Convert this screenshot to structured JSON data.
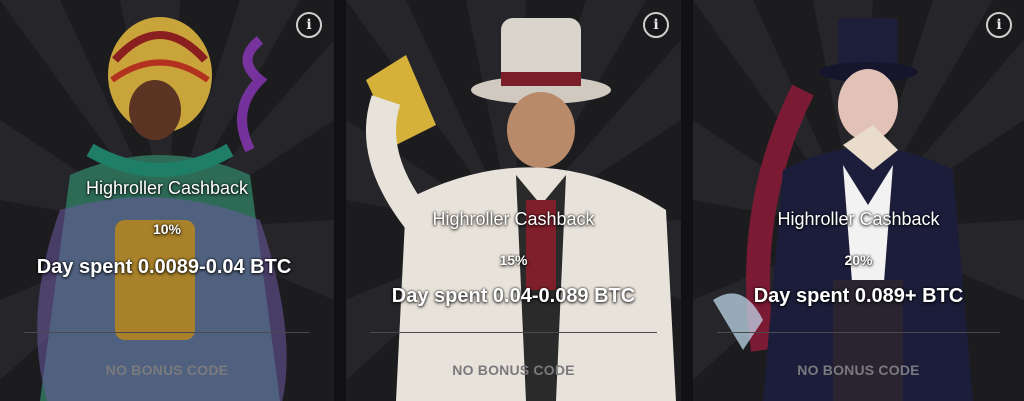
{
  "cards": [
    {
      "title": "Highroller Cashback",
      "percent": "10%",
      "spent": "Day spent 0.0089-0.04 BTC",
      "code": "NO BONUS CODE",
      "info_icon": "i"
    },
    {
      "title": "Highroller Cashback",
      "percent": "15%",
      "spent": "Day spent 0.04-0.089 BTC",
      "code": "NO BONUS CODE",
      "info_icon": "i"
    },
    {
      "title": "Highroller Cashback",
      "percent": "20%",
      "spent": "Day spent 0.089+ BTC",
      "code": "NO BONUS CODE",
      "info_icon": "i"
    }
  ],
  "colors": {
    "background": "#1b1b1e",
    "text": "#ffffff",
    "code_text": "#7a7a7e"
  }
}
